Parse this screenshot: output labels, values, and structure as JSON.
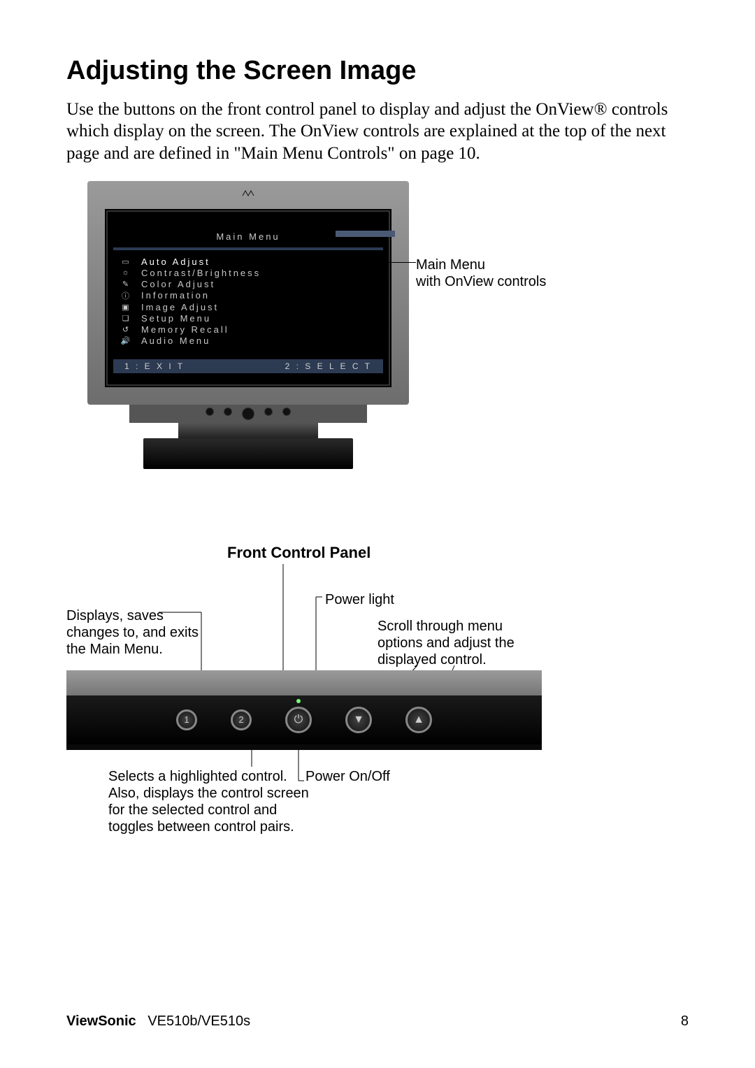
{
  "title": "Adjusting the Screen Image",
  "intro": "Use the buttons on the front control panel to display and adjust the OnView® controls which display on the screen. The OnView controls are explained at the top of the next page and are defined in \"Main Menu Controls\" on page 10.",
  "osd": {
    "title": "Main Menu",
    "items": [
      {
        "label": "Auto Adjust"
      },
      {
        "label": "Contrast/Brightness"
      },
      {
        "label": "Color Adjust"
      },
      {
        "label": "Information"
      },
      {
        "label": "Image Adjust"
      },
      {
        "label": "Setup Menu"
      },
      {
        "label": "Memory Recall"
      },
      {
        "label": "Audio Menu"
      }
    ],
    "footer_left": "1 : E X I T",
    "footer_right": "2 : S E L E C T"
  },
  "callouts": {
    "main_menu_1": "Main Menu",
    "main_menu_2": "with OnView controls",
    "front_panel_title": "Front Control Panel",
    "displays": "Displays, saves changes to, and exits the Main Menu.",
    "power_light": "Power light",
    "scroll": "Scroll through menu options and adjust the displayed control.",
    "selects": "Selects a highlighted control. Also, displays the control screen for the selected control and toggles between control pairs.",
    "power_onoff": "Power On/Off"
  },
  "panel_buttons": {
    "b1": "1",
    "b2": "2",
    "power": "⏻",
    "down": "▼",
    "up": "▲"
  },
  "footer": {
    "brand": "ViewSonic",
    "model": "VE510b/VE510s",
    "page": "8"
  }
}
